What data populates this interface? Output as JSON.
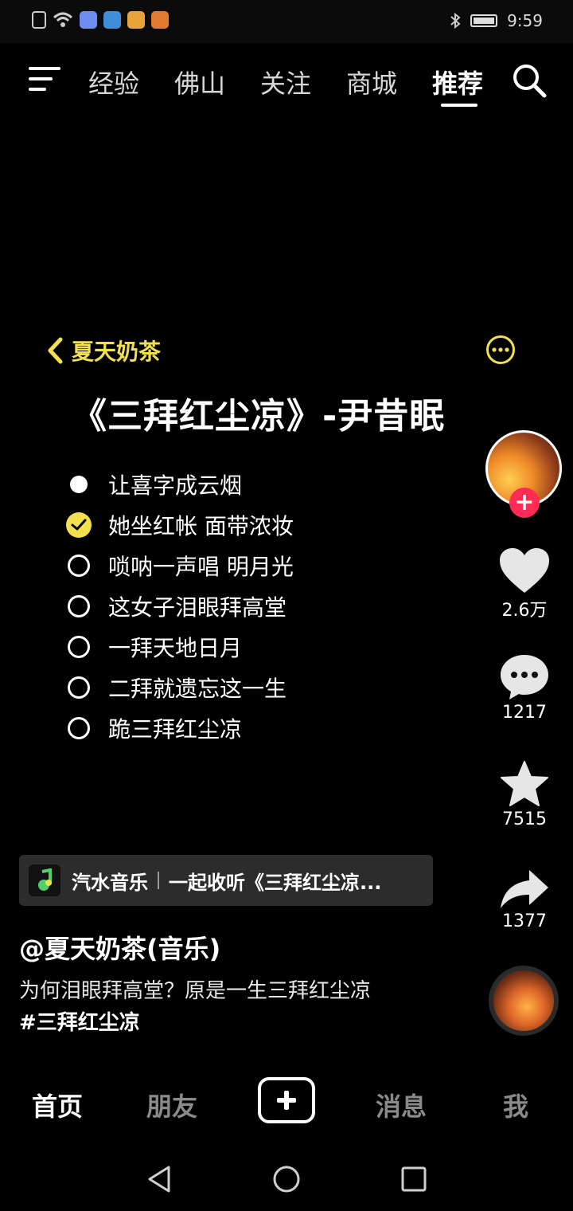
{
  "status_bar": {
    "time": "9:59"
  },
  "top_nav": {
    "tabs": [
      "经验",
      "佛山",
      "关注",
      "商城",
      "推荐"
    ],
    "active_tab": "推荐"
  },
  "card": {
    "back_label": "夏天奶茶",
    "title": "《三拜红尘凉》-尹昔眠",
    "lyrics": [
      {
        "text": "让喜字成云烟",
        "state": "dot"
      },
      {
        "text": "她坐红帐 面带浓妆",
        "state": "checked"
      },
      {
        "text": "唢呐一声唱 明月光",
        "state": "empty"
      },
      {
        "text": "这女子泪眼拜高堂",
        "state": "empty"
      },
      {
        "text": "一拜天地日月",
        "state": "empty"
      },
      {
        "text": "二拜就遗忘这一生",
        "state": "empty"
      },
      {
        "text": "跪三拜红尘凉",
        "state": "empty"
      }
    ]
  },
  "actions": {
    "likes": "2.6万",
    "comments": "1217",
    "favorites": "7515",
    "shares": "1377"
  },
  "music_bar": {
    "app": "汽水音乐",
    "track": "一起收听《三拜红尘凉..."
  },
  "post": {
    "author": "@夏天奶茶(音乐)",
    "description": "为何泪眼拜高堂？原是一生三拜红尘凉",
    "hashtag": "#三拜红尘凉"
  },
  "bottom_nav": {
    "home": "首页",
    "friends": "朋友",
    "messages": "消息",
    "me": "我"
  },
  "colors": {
    "accent_yellow": "#f3e04f",
    "follow_red": "#fe2c55"
  }
}
